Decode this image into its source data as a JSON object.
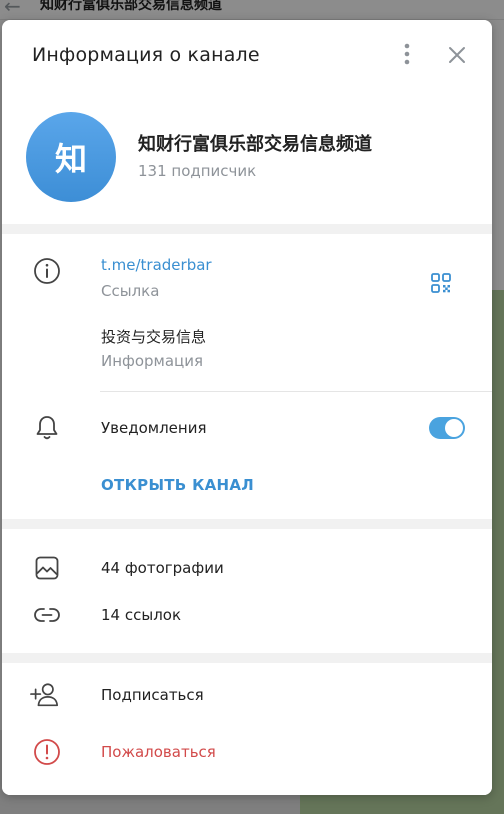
{
  "background": {
    "title": "知财行富俱乐部交易信息频道"
  },
  "dialog": {
    "title": "Информация о канале",
    "menu_icon": "more-vertical-icon",
    "close_icon": "close-icon"
  },
  "channel": {
    "avatar_letter": "知",
    "name": "知财行富俱乐部交易信息频道",
    "subscribers": "131 подписчик",
    "avatar_color": "#4a9be0"
  },
  "info": {
    "link": "t.me/traderbar",
    "link_label": "Ссылка",
    "description": "投资与交易信息",
    "description_label": "Информация",
    "notifications_label": "Уведомления",
    "notifications_on": true,
    "open_channel": "ОТКРЫТЬ КАНАЛ"
  },
  "media": {
    "photos": "44 фотографии",
    "links": "14 ссылок"
  },
  "actions": {
    "subscribe": "Подписаться",
    "report": "Пожаловаться"
  },
  "colors": {
    "accent": "#3a8fd1",
    "danger": "#d24a4a",
    "toggle": "#4aa3df"
  }
}
